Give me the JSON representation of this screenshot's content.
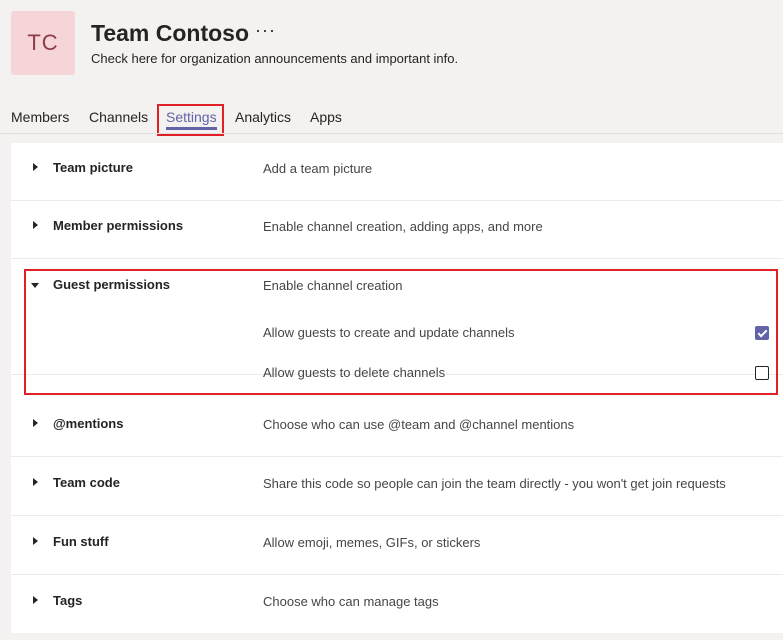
{
  "header": {
    "avatar_initials": "TC",
    "team_name": "Team Contoso",
    "more_label": "···",
    "subtitle": "Check here for organization announcements and important info."
  },
  "tabs": [
    {
      "label": "Members",
      "active": false
    },
    {
      "label": "Channels",
      "active": false
    },
    {
      "label": "Settings",
      "active": true
    },
    {
      "label": "Analytics",
      "active": false
    },
    {
      "label": "Apps",
      "active": false
    }
  ],
  "settings": {
    "team_picture": {
      "title": "Team picture",
      "desc": "Add a team picture"
    },
    "member_permissions": {
      "title": "Member permissions",
      "desc": "Enable channel creation, adding apps, and more"
    },
    "guest_permissions": {
      "title": "Guest permissions",
      "desc": "Enable channel creation",
      "options": [
        {
          "label": "Allow guests to create and update channels",
          "checked": true
        },
        {
          "label": "Allow guests to delete channels",
          "checked": false
        }
      ]
    },
    "mentions": {
      "title": "@mentions",
      "desc": "Choose who can use @team and @channel mentions"
    },
    "team_code": {
      "title": "Team code",
      "desc": "Share this code so people can join the team directly - you won't get join requests"
    },
    "fun_stuff": {
      "title": "Fun stuff",
      "desc": "Allow emoji, memes, GIFs, or stickers"
    },
    "tags": {
      "title": "Tags",
      "desc": "Choose who can manage tags"
    }
  },
  "colors": {
    "accent": "#6264a7",
    "highlight": "#e01f26",
    "avatar_bg": "#f6d5d8"
  }
}
